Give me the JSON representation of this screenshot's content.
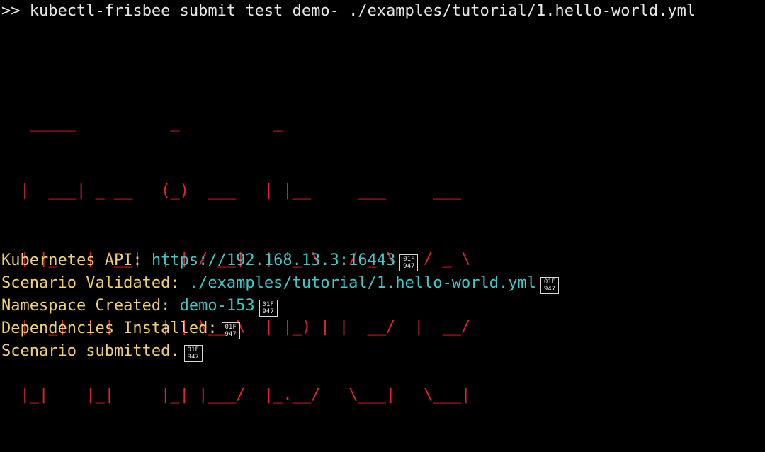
{
  "command": {
    "prompt": ">>",
    "text": "kubectl-frisbee submit test demo- ./examples/tutorial/1.hello-world.yml"
  },
  "banner": {
    "lines": [
      "   _____          _          _                      ",
      "  |  ___| _ __   (_)  ___   | |__     ___     ___   ",
      "  | |_   | '__|  | | / __|  | '_ \\   / _ \\   / _ \\  ",
      "  |  _|  | |     | | \\__ \\  | |_) | |  __/  |  __/  ",
      "  |_|    |_|     |_| |___/  |_.__/   \\___|   \\___|  "
    ],
    "color": "#e8222a"
  },
  "status": [
    {
      "key": "Kubernetes API:",
      "value": "https://192.168.13.3:16443",
      "icon": "missing-glyph-icon",
      "glyph_code": "01F947"
    },
    {
      "key": "Scenario Validated:",
      "value": "./examples/tutorial/1.hello-world.yml",
      "icon": "missing-glyph-icon",
      "glyph_code": "01F947"
    },
    {
      "key": "Namespace Created:",
      "value": "demo-153",
      "icon": "missing-glyph-icon",
      "glyph_code": "01F947"
    },
    {
      "key": "Dependencies Installed:",
      "value": "",
      "icon": "missing-glyph-icon",
      "glyph_code": "01F947"
    },
    {
      "key": "Scenario submitted.",
      "value": "",
      "icon": "missing-glyph-icon",
      "glyph_code": "01F947"
    }
  ],
  "colors": {
    "background": "#000000",
    "key": "#f0d070",
    "value": "#3fc8c8",
    "command": "#e6e6e6"
  }
}
